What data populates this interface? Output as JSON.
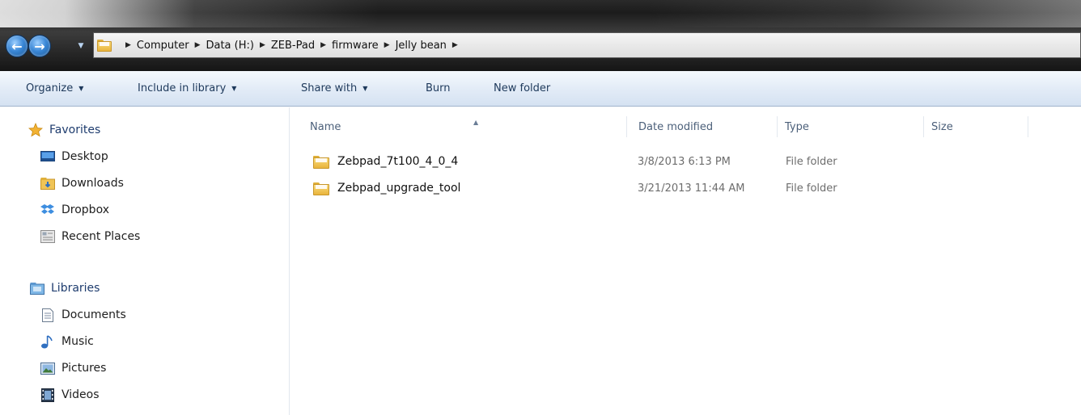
{
  "address": {
    "crumbs": [
      "Computer",
      "Data (H:)",
      "ZEB-Pad",
      "firmware",
      "Jelly bean"
    ]
  },
  "toolbar": {
    "organize_label": "Organize",
    "include_label": "Include in library",
    "share_label": "Share with",
    "burn_label": "Burn",
    "new_folder_label": "New folder"
  },
  "nav": {
    "favorites_title": "Favorites",
    "favorites": [
      "Desktop",
      "Downloads",
      "Dropbox",
      "Recent Places"
    ],
    "libraries_title": "Libraries",
    "libraries": [
      "Documents",
      "Music",
      "Pictures",
      "Videos"
    ]
  },
  "columns": {
    "name": "Name",
    "date": "Date modified",
    "type": "Type",
    "size": "Size"
  },
  "files": [
    {
      "name": "Zebpad_7t100_4_0_4",
      "date": "3/8/2013 6:13 PM",
      "type": "File folder",
      "size": ""
    },
    {
      "name": "Zebpad_upgrade_tool",
      "date": "3/21/2013 11:44 AM",
      "type": "File folder",
      "size": ""
    }
  ],
  "colors": {
    "command_bar": "#dbe6f4",
    "nav_accent": "#1e3c6e",
    "folder": "#e9b43c"
  }
}
